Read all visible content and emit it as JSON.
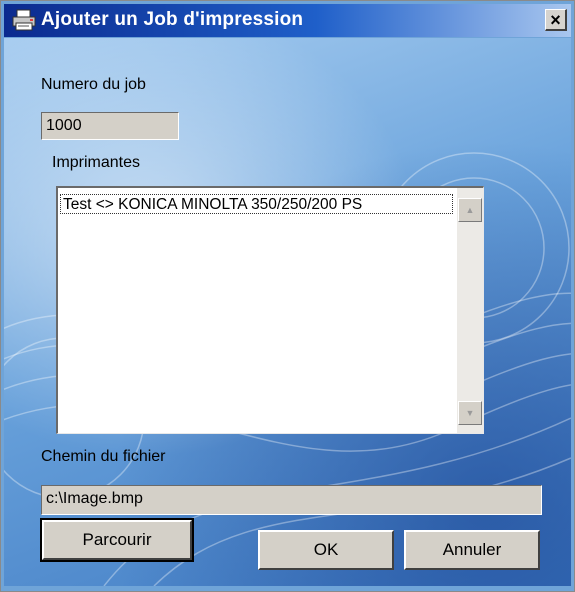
{
  "window": {
    "title": "Ajouter un Job d'impression",
    "close_glyph": "×"
  },
  "job": {
    "label": "Numero du job",
    "value": "1000"
  },
  "printers": {
    "label": "Imprimantes",
    "items": [
      "Test <> KONICA MINOLTA 350/250/200 PS"
    ]
  },
  "file": {
    "label": "Chemin du fichier",
    "value": "c:\\Image.bmp"
  },
  "buttons": {
    "browse": "Parcourir",
    "ok": "OK",
    "cancel": "Annuler"
  },
  "icons": {
    "title": "printer-icon",
    "close": "close-icon",
    "scroll_up": "scroll-up-arrow-icon",
    "scroll_down": "scroll-down-arrow-icon"
  },
  "colors": {
    "titlebar_start": "#0b2a8e",
    "titlebar_end": "#a9c7ef",
    "background": "#6aa3dc",
    "control_face": "#d4d0c8"
  }
}
